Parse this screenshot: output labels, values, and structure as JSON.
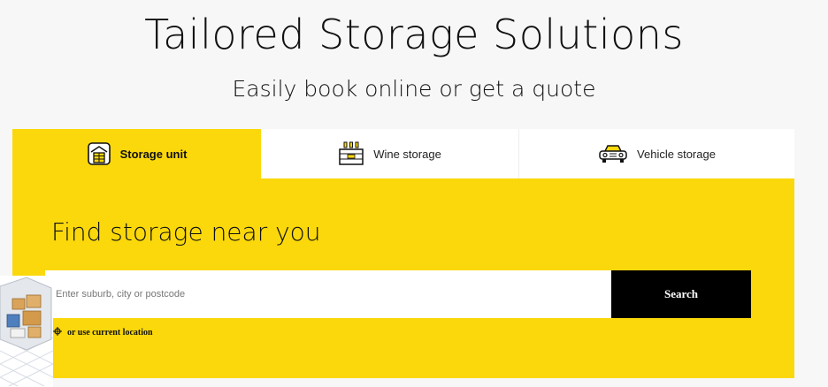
{
  "header": {
    "title": "Tailored Storage Solutions",
    "subtitle": "Easily book online or get a quote"
  },
  "tabs": [
    {
      "label": "Storage unit",
      "icon": "storage-unit-icon",
      "active": true
    },
    {
      "label": "Wine storage",
      "icon": "wine-bottles-icon",
      "active": false
    },
    {
      "label": "Vehicle storage",
      "icon": "car-icon",
      "active": false
    }
  ],
  "search": {
    "heading": "Find storage near you",
    "placeholder": "Enter suburb, city or postcode",
    "value": "",
    "button_label": "Search",
    "location_label": "or use current location"
  },
  "colors": {
    "accent": "#fbd80b",
    "button_bg": "#000000",
    "page_bg": "#f7f7f7"
  }
}
